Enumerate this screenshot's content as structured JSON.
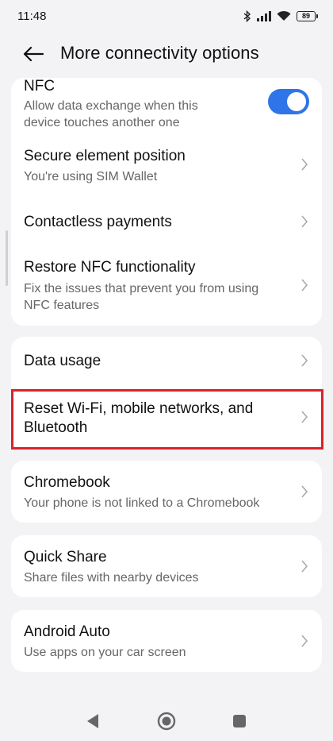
{
  "status": {
    "time": "11:48",
    "battery": "89"
  },
  "header": {
    "title": "More connectivity options"
  },
  "nfc_card": {
    "nfc": {
      "title": "NFC",
      "subtitle_line1": "Allow data exchange when this",
      "subtitle_line2": "device touches another one",
      "enabled": true
    },
    "secure_element": {
      "title": "Secure element position",
      "subtitle": "You're using SIM  Wallet"
    },
    "contactless": {
      "title": "Contactless payments"
    },
    "restore": {
      "title": "Restore NFC functionality",
      "subtitle_line1": "Fix the issues that prevent you from using",
      "subtitle_line2": "NFC features"
    }
  },
  "network_card": {
    "data_usage": {
      "title": "Data usage"
    },
    "reset": {
      "title_line1": "Reset Wi-Fi, mobile networks, and",
      "title_line2": "Bluetooth"
    }
  },
  "chromebook": {
    "title": "Chromebook",
    "subtitle": "Your phone is not linked to a Chromebook"
  },
  "quick_share": {
    "title": "Quick Share",
    "subtitle": "Share files with nearby devices"
  },
  "android_auto": {
    "title": "Android Auto",
    "subtitle": "Use apps on your car screen"
  },
  "colors": {
    "accent": "#2f74e8",
    "highlight": "#d9222a"
  },
  "icons": [
    "back-arrow-icon",
    "bluetooth-icon",
    "signal-icon",
    "wifi-icon",
    "battery-icon",
    "chevron-right-icon",
    "nav-back-icon",
    "nav-home-icon",
    "nav-recent-icon"
  ]
}
